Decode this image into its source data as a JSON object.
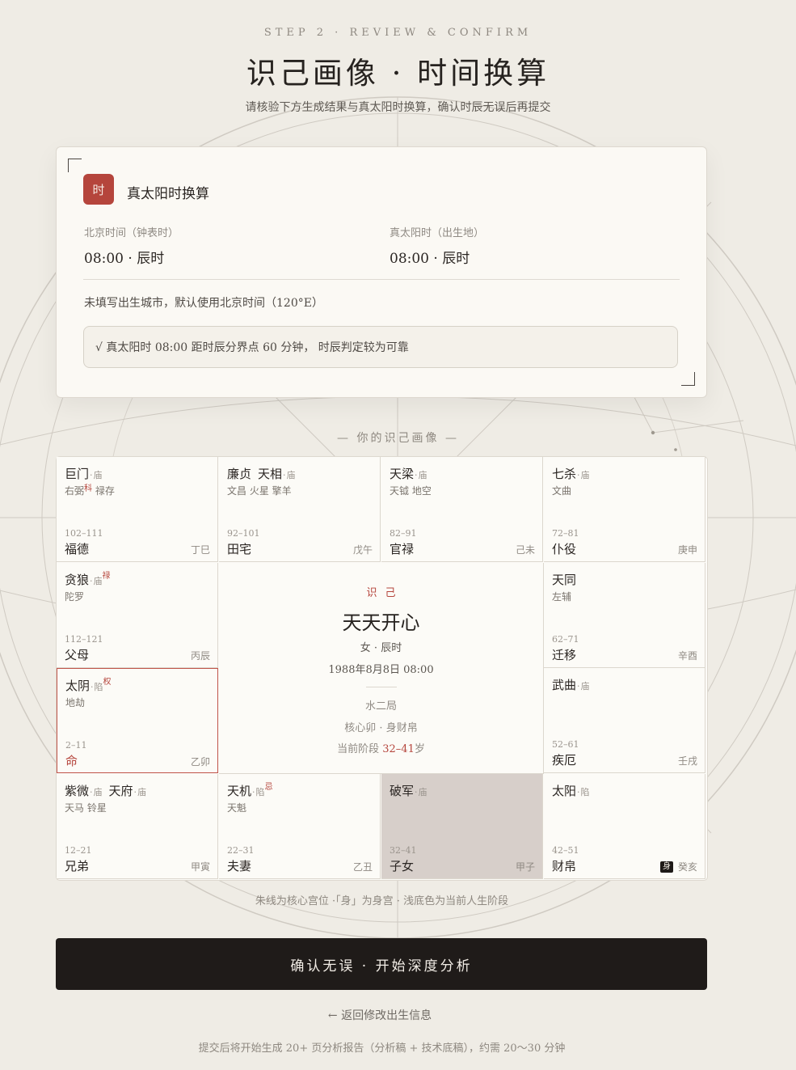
{
  "header": {
    "step": "STEP 2 · REVIEW & CONFIRM",
    "title": "识己画像 · 时间换算",
    "subtitle": "请核验下方生成结果与真太阳时换算，确认时辰无误后再提交"
  },
  "solar_card": {
    "seal": "时",
    "title": "真太阳时换算",
    "beijing_label": "北京时间（钟表时）",
    "beijing_value": "08:00 · 辰时",
    "solar_label": "真太阳时（出生地）",
    "solar_value": "08:00 · 辰时",
    "note": "未填写出生城市，默认使用北京时间（120°E）",
    "check_text": "√ 真太阳时 08:00 距时辰分界点 60 分钟， 时辰判定较为可靠"
  },
  "section_label": "— 你的识己画像 —",
  "chart": {
    "cells": [
      {
        "id": "si",
        "stars": [
          {
            "name": "巨门",
            "status": "庙"
          }
        ],
        "minor": "右弼科 禄存",
        "range": "102–111",
        "palace": "福德",
        "ganzhi": "丁巳"
      },
      {
        "id": "wu",
        "stars": [
          {
            "name": "廉贞"
          },
          {
            "name": "天相",
            "status": "庙"
          }
        ],
        "minor": "文昌 火星 擎羊",
        "range": "92–101",
        "palace": "田宅",
        "ganzhi": "戊午"
      },
      {
        "id": "wei",
        "stars": [
          {
            "name": "天梁",
            "status": "庙"
          }
        ],
        "minor": "天钺 地空",
        "range": "82–91",
        "palace": "官禄",
        "ganzhi": "己未"
      },
      {
        "id": "shen",
        "stars": [
          {
            "name": "七杀",
            "status": "庙"
          }
        ],
        "minor": "文曲",
        "range": "72–81",
        "palace": "仆役",
        "ganzhi": "庚申"
      },
      {
        "id": "chen",
        "stars": [
          {
            "name": "贪狼",
            "status": "庙",
            "mutagen": "禄"
          }
        ],
        "minor": "陀罗",
        "range": "112–121",
        "palace": "父母",
        "ganzhi": "丙辰"
      },
      {
        "id": "you",
        "stars": [
          {
            "name": "天同"
          }
        ],
        "minor": "左辅",
        "range": "62–71",
        "palace": "迁移",
        "ganzhi": "辛酉"
      },
      {
        "id": "mao",
        "stars": [
          {
            "name": "太阴",
            "status": "陷",
            "mutagen": "权"
          }
        ],
        "minor": "地劫",
        "range": "2–11",
        "palace": "命",
        "ganzhi": "乙卯"
      },
      {
        "id": "xu",
        "stars": [
          {
            "name": "武曲",
            "status": "庙"
          }
        ],
        "minor": "",
        "range": "52–61",
        "palace": "疾厄",
        "ganzhi": "壬戌"
      },
      {
        "id": "yin",
        "stars": [
          {
            "name": "紫微",
            "status": "庙"
          },
          {
            "name": "天府",
            "status": "庙"
          }
        ],
        "minor": "天马 铃星",
        "range": "12–21",
        "palace": "兄弟",
        "ganzhi": "甲寅"
      },
      {
        "id": "chou",
        "stars": [
          {
            "name": "天机",
            "status": "陷",
            "mutagen": "忌"
          }
        ],
        "minor": "天魁",
        "range": "22–31",
        "palace": "夫妻",
        "ganzhi": "乙丑"
      },
      {
        "id": "zi",
        "stars": [
          {
            "name": "破军",
            "status": "庙"
          }
        ],
        "minor": "",
        "range": "32–41",
        "palace": "子女",
        "ganzhi": "甲子"
      },
      {
        "id": "hai",
        "stars": [
          {
            "name": "太阳",
            "status": "陷"
          }
        ],
        "minor": "",
        "range": "42–51",
        "palace": "财帛",
        "ganzhi": "癸亥",
        "badge": "身"
      }
    ],
    "center": {
      "tag": "识己",
      "name": "天天开心",
      "gender_time": "女 · 辰时",
      "birth": "1988年8月8日 08:00",
      "element": "水二局",
      "core": "核心卯 · 身财帛",
      "stage_prefix": "当前阶段 ",
      "stage_value": "32–41",
      "stage_suffix": "岁"
    }
  },
  "legend": "朱线为核心宫位 ·「身」为身宫 · 浅底色为当前人生阶段",
  "cta_label": "确认无误 · 开始深度分析",
  "back_label": "← 返回修改出生信息",
  "footer_note": "提交后将开始生成 20+ 页分析报告（分析稿 + 技术底稿），约需 20～30 分钟",
  "colors": {
    "accent": "#b5453c",
    "background": "#efece5",
    "button": "#1f1b19",
    "current_stage": "#d7cfca"
  }
}
